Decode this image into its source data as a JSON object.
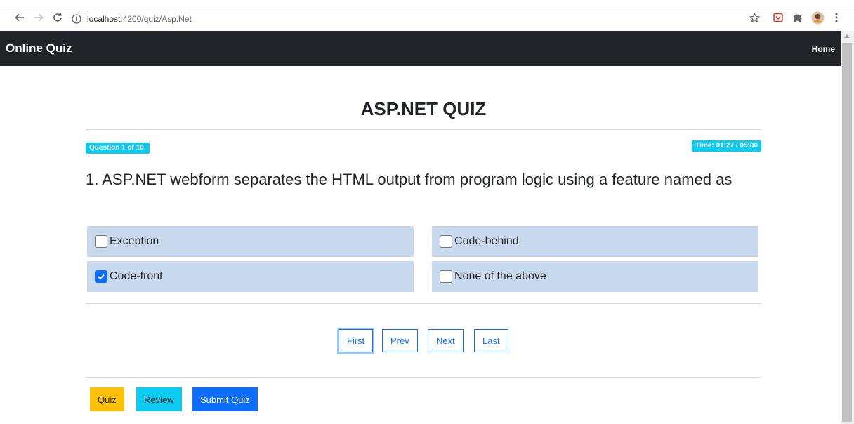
{
  "browser": {
    "url_host": "localhost",
    "url_rest": ":4200/quiz/Asp.Net",
    "icons": [
      "back-arrow-icon",
      "forward-arrow-icon",
      "reload-icon",
      "info-icon",
      "star-icon",
      "shield-extension-icon",
      "puzzle-extensions-icon",
      "profile-avatar-icon",
      "more-vert-icon"
    ]
  },
  "navbar": {
    "brand": "Online Quiz",
    "home_link": "Home"
  },
  "quiz": {
    "title": "ASP.NET QUIZ",
    "progress_badge": "Question 1 of 10.",
    "timer_badge": "Time: 01:27 / 05:00",
    "question_text": "1. ASP.NET webform separates the HTML output from program logic using a feature named as",
    "options": [
      {
        "label": "Exception",
        "checked": false
      },
      {
        "label": "Code-behind",
        "checked": false
      },
      {
        "label": "Code-front",
        "checked": true
      },
      {
        "label": "None of the above",
        "checked": false
      }
    ]
  },
  "pager": {
    "first": "First",
    "prev": "Prev",
    "next": "Next",
    "last": "Last",
    "focused": "First"
  },
  "footer": {
    "quiz": "Quiz",
    "review": "Review",
    "submit": "Submit Quiz"
  },
  "colors": {
    "navbar": "#212529",
    "info_badge": "#0dcaf0",
    "option_bg": "#c9d9ee",
    "primary": "#0d6efd",
    "warning": "#ffc107",
    "info": "#0dcaf0"
  }
}
